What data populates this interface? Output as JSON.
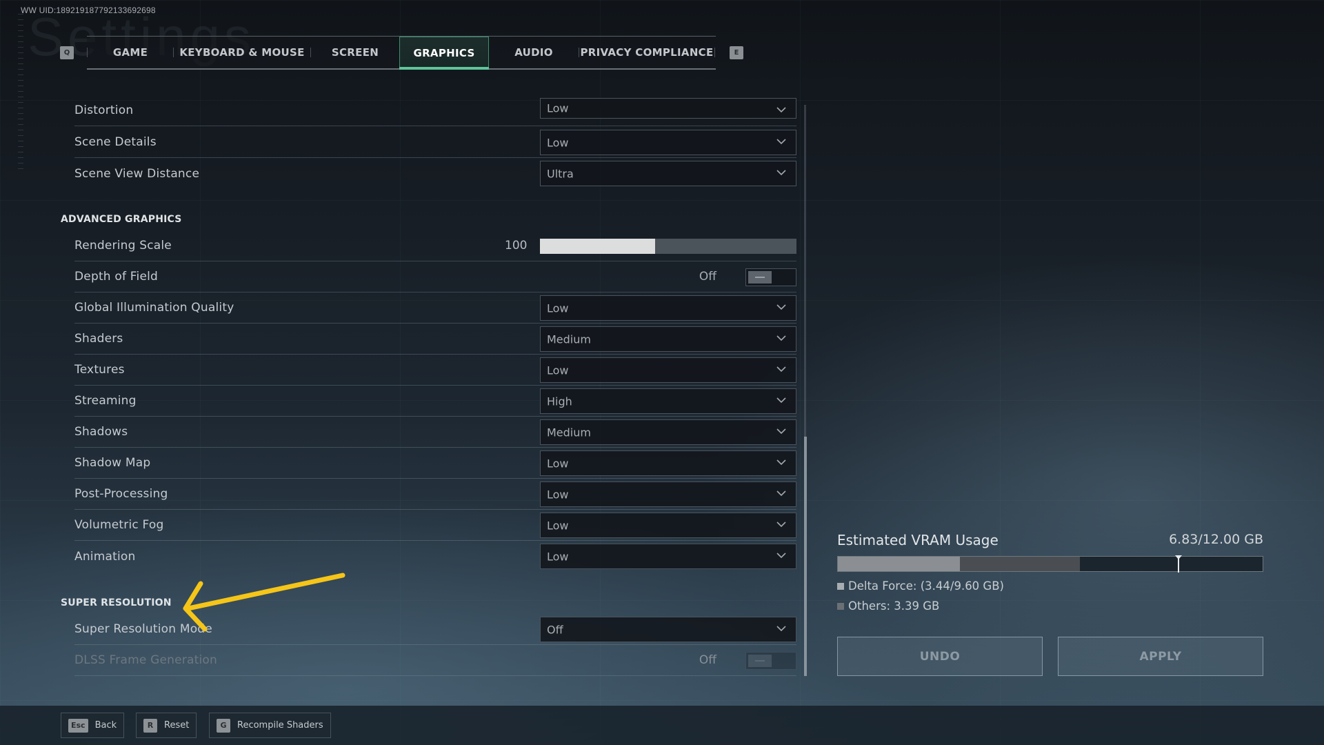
{
  "header": {
    "uid": "WW UID:189219187792133692698",
    "background_title": "Settings",
    "prev_tab_key": "Q",
    "next_tab_key": "E"
  },
  "tabs": [
    {
      "label": "GAME",
      "active": false
    },
    {
      "label": "KEYBOARD & MOUSE",
      "active": false
    },
    {
      "label": "SCREEN",
      "active": false
    },
    {
      "label": "GRAPHICS",
      "active": true
    },
    {
      "label": "AUDIO",
      "active": false
    },
    {
      "label": "PRIVACY COMPLIANCE",
      "active": false
    }
  ],
  "settings_top": [
    {
      "label": "Distortion",
      "value": "Low"
    },
    {
      "label": "Scene Details",
      "value": "Low"
    },
    {
      "label": "Scene View Distance",
      "value": "Ultra"
    }
  ],
  "advanced": {
    "heading": "ADVANCED GRAPHICS",
    "rendering_scale": {
      "label": "Rendering Scale",
      "value": "100",
      "slider_fraction": 0.45
    },
    "depth_of_field": {
      "label": "Depth of Field",
      "value": "Off"
    },
    "dropdowns": [
      {
        "label": "Global Illumination Quality",
        "value": "Low"
      },
      {
        "label": "Shaders",
        "value": "Medium"
      },
      {
        "label": "Textures",
        "value": "Low"
      },
      {
        "label": "Streaming",
        "value": "High"
      },
      {
        "label": "Shadows",
        "value": "Medium"
      },
      {
        "label": "Shadow Map",
        "value": "Low"
      },
      {
        "label": "Post-Processing",
        "value": "Low"
      },
      {
        "label": "Volumetric Fog",
        "value": "Low"
      },
      {
        "label": "Animation",
        "value": "Low"
      }
    ]
  },
  "super_resolution": {
    "heading": "SUPER RESOLUTION",
    "mode": {
      "label": "Super Resolution Mode",
      "value": "Off"
    },
    "dlss_frame_generation": {
      "label": "DLSS Frame Generation",
      "value": "Off",
      "disabled": true
    }
  },
  "vram": {
    "title": "Estimated VRAM Usage",
    "total_text": "6.83/12.00 GB",
    "total_gb": 12.0,
    "delta_force_gb": 3.44,
    "delta_force_limit_gb": 9.6,
    "others_gb": 3.39,
    "delta_force_label": "Delta Force: (3.44/9.60 GB)",
    "others_label": "Others: 3.39 GB",
    "colors": {
      "delta_force": "#8b8f93",
      "others": "#4a4e52",
      "free": "#1b252d"
    }
  },
  "actions": {
    "undo_label": "UNDO",
    "apply_label": "APPLY"
  },
  "footer": {
    "hints": [
      {
        "key": "Esc",
        "label": "Back"
      },
      {
        "key": "R",
        "label": "Reset"
      },
      {
        "key": "G",
        "label": "Recompile Shaders"
      }
    ]
  },
  "colors": {
    "accent": "#5fc49a",
    "annotation_arrow": "#f5c518"
  }
}
